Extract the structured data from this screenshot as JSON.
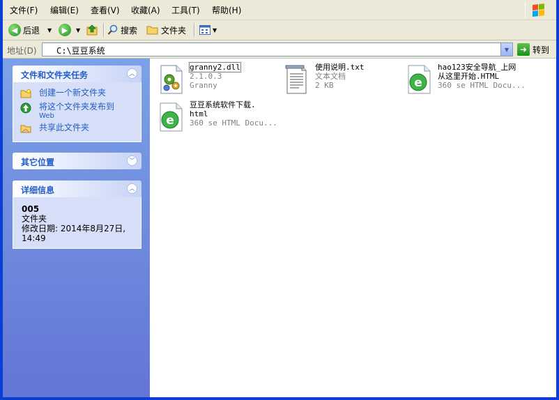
{
  "menu": [
    {
      "id": "file",
      "label": "文件(F)"
    },
    {
      "id": "edit",
      "label": "编辑(E)"
    },
    {
      "id": "view",
      "label": "查看(V)"
    },
    {
      "id": "favorites",
      "label": "收藏(A)"
    },
    {
      "id": "tools",
      "label": "工具(T)"
    },
    {
      "id": "help",
      "label": "帮助(H)"
    }
  ],
  "toolbar": {
    "back_label": "后退",
    "search_label": "搜索",
    "folders_label": "文件夹"
  },
  "address": {
    "label": "地址(D)",
    "path": "C:\\豆豆系统",
    "go_label": "转到"
  },
  "tasks_panel": {
    "title": "文件和文件夹任务",
    "items": [
      {
        "label": "创建一个新文件夹",
        "icon": "new-folder-icon"
      },
      {
        "label": "将这个文件夹发布到",
        "label2": "Web",
        "icon": "publish-web-icon"
      },
      {
        "label": "共享此文件夹",
        "icon": "share-folder-icon"
      }
    ]
  },
  "other_places_panel": {
    "title": "其它位置"
  },
  "details_panel": {
    "title": "详细信息",
    "name": "005",
    "type": "文件夹",
    "modified": "修改日期: 2014年8月27日,",
    "modified2": "14:49"
  },
  "files": [
    {
      "name": "granny2.dll",
      "line2": "2.1.0.3",
      "line3": "Granny",
      "icon": "dll-file-icon"
    },
    {
      "name": "使用说明.txt",
      "line2": "文本文档",
      "line3": "2 KB",
      "icon": "text-document-icon"
    },
    {
      "name": "hao123安全导航_上网",
      "name2": "从这里开始.HTML",
      "line3": "360 se HTML Docu...",
      "icon": "360-browser-icon"
    },
    {
      "name": "豆豆系统软件下载.",
      "name2": "html",
      "line3": "360 se HTML Docu...",
      "icon": "360-browser-icon"
    }
  ],
  "colors": {
    "accent": "#215dc6",
    "frame": "#0a3fd4",
    "pane_top": "#7ba2e7",
    "pane_bottom": "#6375d6"
  }
}
